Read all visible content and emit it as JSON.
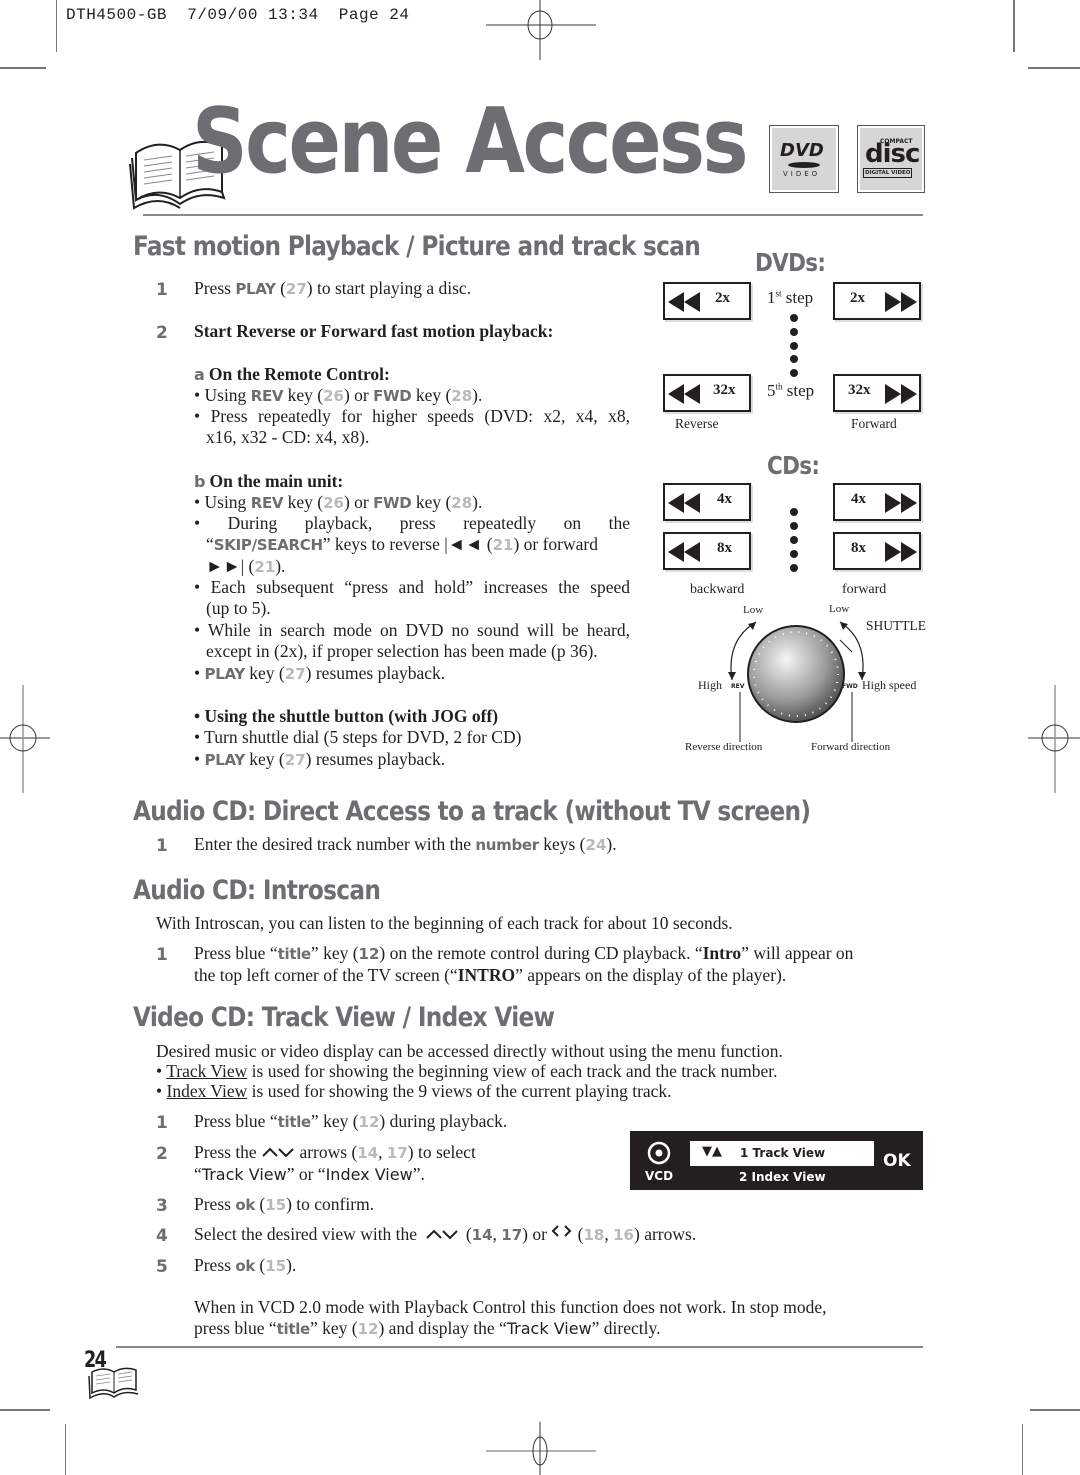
{
  "slug": {
    "text": "DTH4500-GB  7/09/00 13:34  Page 24"
  },
  "header": {
    "title": "Scene Access",
    "logos": {
      "dvd_top": "DVD",
      "dvd_bottom": "VIDEO",
      "cd_compact": "COMPACT",
      "cd_disc": "disc",
      "cd_digital": "DIGITAL VIDEO"
    }
  },
  "section1": {
    "heading": "Fast motion Playback / Picture and track scan",
    "step1": {
      "num": "1",
      "pre": "Press ",
      "key": "PLAY",
      "ref": "27",
      "post": ") to start playing a disc."
    },
    "step2": {
      "num": "2",
      "text": "Start Reverse or Forward fast motion playback:"
    },
    "sub_a": {
      "letter": "a",
      "title": " On the Remote Control:"
    },
    "a_b1": {
      "p1": "• Using ",
      "k1": "REV",
      "p2": " key (",
      "r1": "26",
      "p3": ") or ",
      "k2": "FWD",
      "p4": " key (",
      "r2": "28",
      "p5": ")."
    },
    "a_b2": {
      "line1": "• Press repeatedly for higher speeds (DVD: x2, x4, x8,",
      "line2": "x16, x32 - CD: x4, x8)."
    },
    "sub_b": {
      "letter": "b",
      "title": " On the main unit:"
    },
    "b_b1": {
      "p1": "• Using ",
      "k1": "REV",
      "p2": " key (",
      "r1": "26",
      "p3": ") or ",
      "k2": "FWD",
      "p4": " key (",
      "r2": "28",
      "p5": ")."
    },
    "b_b2": {
      "line1": "• During playback, press repeatedly on the",
      "q1": "“",
      "key": "SKIP/SEARCH",
      "mid": "” keys to reverse  |◄◄ (",
      "r1": "21",
      "mid2": ") or forward",
      "line3a": "►►| (",
      "r2": "21",
      "line3b": ")."
    },
    "b_b3": {
      "line1": "• Each subsequent “press and hold” increases the speed",
      "line2": "(up to 5)."
    },
    "b_b4": {
      "line1": "• While in search mode on DVD no sound will be heard,",
      "line2": "except in (2x), if proper selection has been made (p 36)."
    },
    "b_b5": {
      "p1": "• ",
      "key": "PLAY",
      "p2": " key (",
      "ref": "27",
      "p3": ") resumes playback."
    },
    "shuttle_title": "• Using the shuttle button (with JOG off)",
    "shuttle_b1": "• Turn shuttle dial (5 steps for DVD, 2 for CD)",
    "shuttle_b2": {
      "p1": "• ",
      "key": "PLAY",
      "p2": " key (",
      "ref": "27",
      "p3": ") resumes playback."
    }
  },
  "diagram": {
    "dvd_heading": "DVDs:",
    "dvd_rev": [
      "2x",
      "32x"
    ],
    "dvd_fwd": [
      "2x",
      "32x"
    ],
    "step1": {
      "n": "1",
      "sup": "st",
      "word": " step"
    },
    "step5": {
      "n": "5",
      "sup": "th",
      "word": " step"
    },
    "reverse": "Reverse",
    "forward": "Forward",
    "cd_heading": "CDs:",
    "cd_rev": [
      "4x",
      "8x"
    ],
    "cd_fwd": [
      "4x",
      "8x"
    ],
    "backward": "backward",
    "forward_lc": "forward",
    "low_left": "Low",
    "low_right": "Low",
    "shuttle": "SHUTTLE",
    "high": "High",
    "high_speed": "High speed",
    "rev": "REV",
    "fwd": "FWD",
    "rev_dir": "Reverse direction",
    "fwd_dir": "Forward direction"
  },
  "section2": {
    "heading": "Audio CD: Direct Access to a track (without TV screen)",
    "step1": {
      "num": "1",
      "p1": "Enter the desired track number with the ",
      "key": "number",
      "p2": " keys (",
      "ref": "24",
      "p3": ")."
    }
  },
  "section3": {
    "heading": "Audio CD: Introscan",
    "intro": "With Introscan, you can listen to the beginning of each track for about 10 seconds.",
    "step1": {
      "num": "1",
      "p1": "Press blue “",
      "key": "title",
      "p2": "” key (",
      "ref": "12",
      "p3": ") on the remote control during CD playback. “",
      "b1": "Intro",
      "p4": "” will appear on",
      "line2a": "the top left corner of the TV screen (“",
      "b2": "INTRO",
      "line2b": "” appears on the display of the player)."
    }
  },
  "section4": {
    "heading": "Video CD: Track View / Index View",
    "intro": "Desired music or video display can be accessed directly without using the menu function.",
    "b1": {
      "pre": "• ",
      "link": "Track View",
      "post": " is used for showing the beginning view of each track and the track number."
    },
    "b2": {
      "pre": "• ",
      "link": "Index View",
      "post": " is used for showing the 9 views of the current playing track."
    },
    "step1": {
      "num": "1",
      "p1": "Press blue “",
      "key": "title",
      "p2": "” key (",
      "ref": "12",
      "p3": ") during playback."
    },
    "step2": {
      "num": "2",
      "p1": "Press the ",
      "p2": " arrows (",
      "r1": "14",
      "sep": ", ",
      "r2": "17",
      "p3": ") to select",
      "l2a": "“",
      "tv": "Track View",
      "l2b": "” or “",
      "iv": "Index View",
      "l2c": "”."
    },
    "step3": {
      "num": "3",
      "p1": "Press ",
      "key": "ok",
      "p2": " (",
      "ref": "15",
      "p3": ") to confirm."
    },
    "step4": {
      "num": "4",
      "p1": "Select the desired view with the ",
      "p2": " (",
      "r1": "14",
      "sep": ", ",
      "r2": "17",
      "p3": ") or ",
      "p4": " (",
      "r3": "18",
      "sep2": ", ",
      "r4": "16",
      "p5": ") arrows."
    },
    "step5": {
      "num": "5",
      "p1": "Press ",
      "key": "ok",
      "p2": " (",
      "ref": "15",
      "p3": ")."
    },
    "osd": {
      "icon_label": "VCD",
      "arrows": "▼▲",
      "item1": "1 Track View",
      "item2": "2 Index View",
      "ok": "OK"
    },
    "note": {
      "line1": "When in VCD 2.0 mode with Playback Control this function does not work. In stop mode,",
      "l2a": "press blue “",
      "key": "title",
      "l2b": "” key (",
      "ref": "12",
      "l2c": ") and display the “",
      "tv": "Track View",
      "l2d": "” directly."
    }
  },
  "footer": {
    "page_number": "24"
  }
}
